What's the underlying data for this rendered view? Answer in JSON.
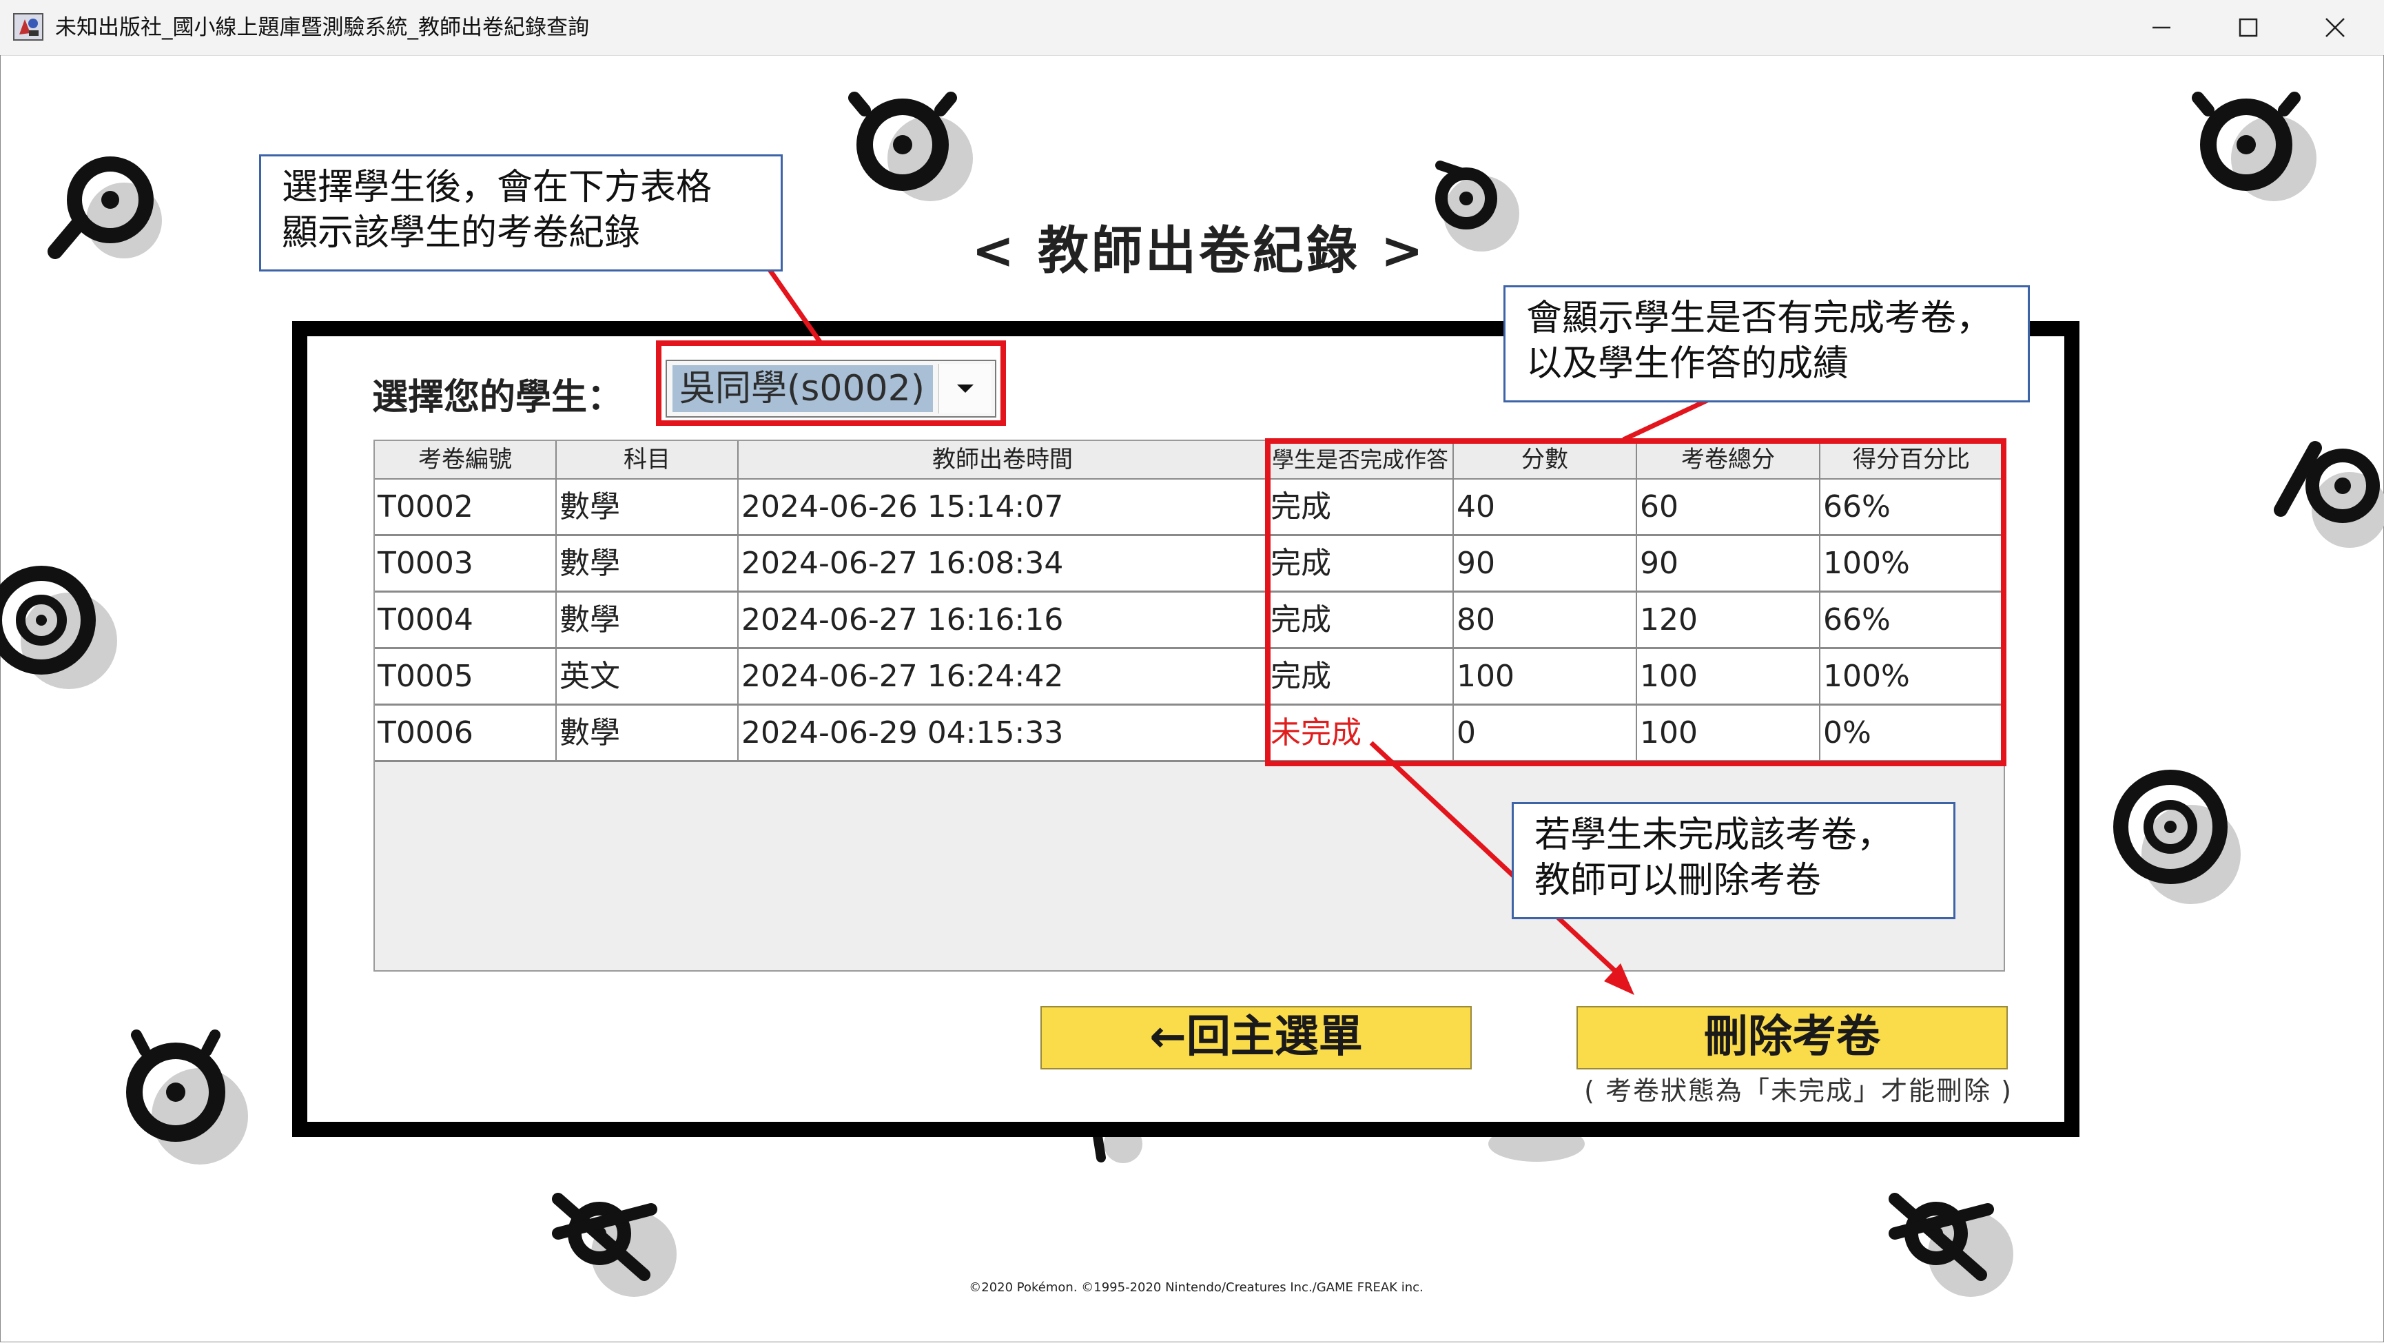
{
  "window": {
    "title": "未知出版社_國小線上題庫暨測驗系統_教師出卷紀錄查詢"
  },
  "page": {
    "title": "< 教師出卷紀錄 >",
    "student_label": "選擇您的學生：",
    "student_selected": "吳同學(s0002)"
  },
  "table": {
    "headers": [
      "考卷編號",
      "科目",
      "教師出卷時間",
      "學生是否完成作答",
      "分數",
      "考卷總分",
      "得分百分比"
    ],
    "rows": [
      [
        "T0002",
        "數學",
        "2024-06-26 15:14:07",
        "完成",
        "40",
        "60",
        "66%"
      ],
      [
        "T0003",
        "數學",
        "2024-06-27 16:08:34",
        "完成",
        "90",
        "90",
        "100%"
      ],
      [
        "T0004",
        "數學",
        "2024-06-27 16:16:16",
        "完成",
        "80",
        "120",
        "66%"
      ],
      [
        "T0005",
        "英文",
        "2024-06-27 16:24:42",
        "完成",
        "100",
        "100",
        "100%"
      ],
      [
        "T0006",
        "數學",
        "2024-06-29 04:15:33",
        "未完成",
        "0",
        "100",
        "0%"
      ]
    ]
  },
  "buttons": {
    "back": "←回主選單",
    "delete": "刪除考卷",
    "delete_hint": "( 考卷狀態為「未完成」才能刪除 )"
  },
  "callouts": {
    "select_student": [
      "選擇學生後，會在下方表格",
      "顯示該學生的考卷紀錄"
    ],
    "show_status": [
      "會顯示學生是否有完成考卷，",
      "以及學生作答的成績"
    ],
    "delete_incomplete": [
      "若學生未完成該考卷，",
      "教師可以刪除考卷"
    ]
  },
  "footer": {
    "copyright": "©2020 Pokémon. ©1995-2020 Nintendo/Creatures Inc./GAME FREAK inc."
  },
  "colors": {
    "accent_red": "#e3141b",
    "button_yellow": "#fadb4a",
    "callout_border": "#3d64a8",
    "incomplete_text": "#e01e1e"
  }
}
